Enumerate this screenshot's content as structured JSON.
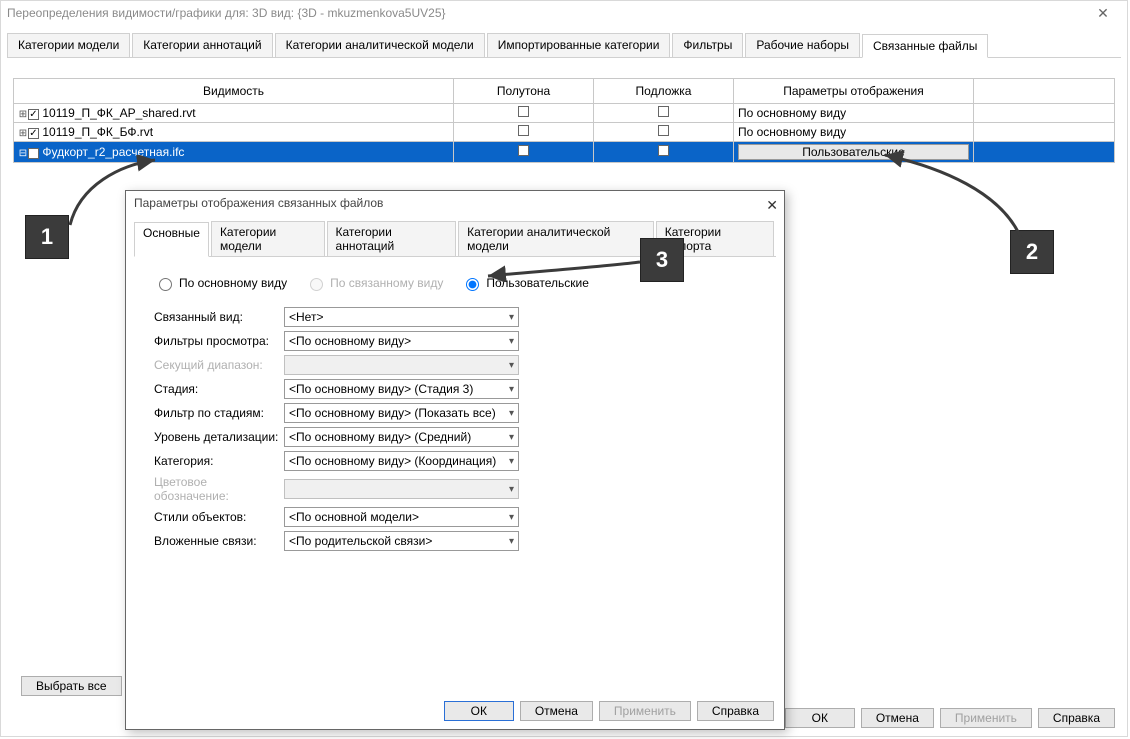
{
  "window_title": "Переопределения видимости/графики для: 3D вид: {3D - mkuzmenkova5UV25}",
  "tabs": [
    "Категории модели",
    "Категории аннотаций",
    "Категории аналитической модели",
    "Импортированные категории",
    "Фильтры",
    "Рабочие наборы",
    "Связанные файлы"
  ],
  "active_tab": 6,
  "columns": {
    "vis": "Видимость",
    "half": "Полутона",
    "under": "Подложка",
    "disp": "Параметры отображения"
  },
  "rows": [
    {
      "name": "10119_П_ФК_АР_shared.rvt",
      "checked": true,
      "half": false,
      "under": false,
      "disp": "По основному виду",
      "expandable": true
    },
    {
      "name": "10119_П_ФК_БФ.rvt",
      "checked": true,
      "half": false,
      "under": false,
      "disp": "По основному виду",
      "expandable": true
    },
    {
      "name": "Фудкорт_r2_расчетная.ifc",
      "checked": true,
      "half": false,
      "under": false,
      "disp": "Пользовательские",
      "selected": true,
      "expandable": true
    }
  ],
  "select_all": "Выбрать все",
  "outer_buttons": {
    "ok": "ОК",
    "cancel": "Отмена",
    "apply": "Применить",
    "help": "Справка"
  },
  "dlg": {
    "title": "Параметры отображения связанных файлов",
    "tabs": [
      "Основные",
      "Категории модели",
      "Категории аннотаций",
      "Категории аналитической модели",
      "Категории импорта"
    ],
    "active_tab": 0,
    "radios": {
      "by_host": "По основному виду",
      "by_linked": "По связанному виду",
      "custom": "Пользовательские"
    },
    "radio_selected": "custom",
    "fields": {
      "linked_view": {
        "label": "Связанный вид:",
        "value": "<Нет>"
      },
      "view_filters": {
        "label": "Фильтры просмотра:",
        "value": "<По основному виду>"
      },
      "view_range": {
        "label": "Секущий диапазон:",
        "value": "",
        "disabled": true
      },
      "phase": {
        "label": "Стадия:",
        "value": "<По основному виду> (Стадия 3)"
      },
      "phase_filter": {
        "label": "Фильтр по стадиям:",
        "value": "<По основному виду> (Показать все)"
      },
      "detail": {
        "label": "Уровень детализации:",
        "value": "<По основному виду> (Средний)"
      },
      "discipline": {
        "label": "Категория:",
        "value": "<По основному виду> (Координация)"
      },
      "color_fill": {
        "label": "Цветовое обозначение:",
        "value": "",
        "disabled": true
      },
      "obj_styles": {
        "label": "Стили объектов:",
        "value": "<По основной модели>"
      },
      "nested": {
        "label": "Вложенные связи:",
        "value": "<По родительской связи>"
      }
    },
    "buttons": {
      "ok": "ОК",
      "cancel": "Отмена",
      "apply": "Применить",
      "help": "Справка"
    }
  },
  "annotations": {
    "a1": "1",
    "a2": "2",
    "a3": "3"
  }
}
